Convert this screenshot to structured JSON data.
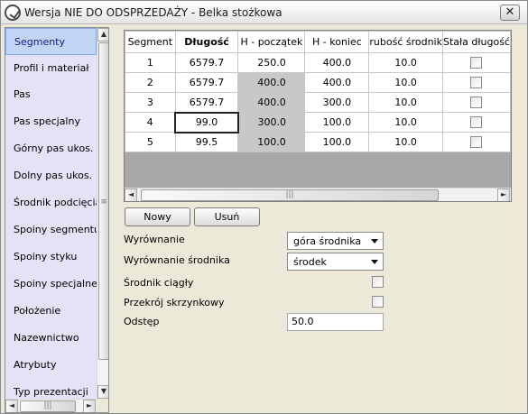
{
  "window": {
    "title": "Wersja NIE DO ODSPRZEDAŻY - Belka stożkowa",
    "close_label": "✕"
  },
  "sidebar": {
    "items": [
      {
        "label": "Segmenty",
        "active": true
      },
      {
        "label": "Profil i materiał"
      },
      {
        "label": "Pas"
      },
      {
        "label": "Pas specjalny"
      },
      {
        "label": "Górny pas ukos."
      },
      {
        "label": "Dolny pas ukos."
      },
      {
        "label": "Środnik podcięcia"
      },
      {
        "label": "Spoiny segmentu"
      },
      {
        "label": "Spoiny styku"
      },
      {
        "label": "Spoiny specjalne"
      },
      {
        "label": "Położenie"
      },
      {
        "label": "Nazewnictwo"
      },
      {
        "label": "Atrybuty"
      },
      {
        "label": "Typ prezentacji"
      }
    ]
  },
  "grid": {
    "columns": [
      "Segment",
      "Długość",
      "H - początek",
      "H - koniec",
      "rubość środnik",
      "Stała długość"
    ],
    "rows": [
      {
        "segment": "1",
        "dlugosc": "6579.7",
        "h_poczatek": "250.0",
        "h_koniec": "400.0",
        "grubosc": "10.0",
        "stala": false
      },
      {
        "segment": "2",
        "dlugosc": "6579.7",
        "h_poczatek": "400.0",
        "h_koniec": "400.0",
        "grubosc": "10.0",
        "stala": false
      },
      {
        "segment": "3",
        "dlugosc": "6579.7",
        "h_poczatek": "400.0",
        "h_koniec": "300.0",
        "grubosc": "10.0",
        "stala": false
      },
      {
        "segment": "4",
        "dlugosc": "99.0",
        "h_poczatek": "300.0",
        "h_koniec": "100.0",
        "grubosc": "10.0",
        "stala": false
      },
      {
        "segment": "5",
        "dlugosc": "99.5",
        "h_poczatek": "100.0",
        "h_koniec": "100.0",
        "grubosc": "10.0",
        "stala": false
      }
    ]
  },
  "buttons": {
    "new_label": "Nowy",
    "delete_label": "Usuń"
  },
  "form": {
    "alignment_label": "Wyrównanie",
    "alignment_value": "góra środnika",
    "web_alignment_label": "Wyrównanie środnika",
    "web_alignment_value": "środek",
    "continuous_web_label": "Środnik ciągły",
    "box_section_label": "Przekrój skrzynkowy",
    "spacing_label": "Odstęp",
    "spacing_value": "50.0"
  },
  "scrollbar": {
    "up": "▲",
    "down": "▼",
    "left": "◄",
    "right": "►",
    "grip": "≡",
    "hgrip": "|||"
  }
}
